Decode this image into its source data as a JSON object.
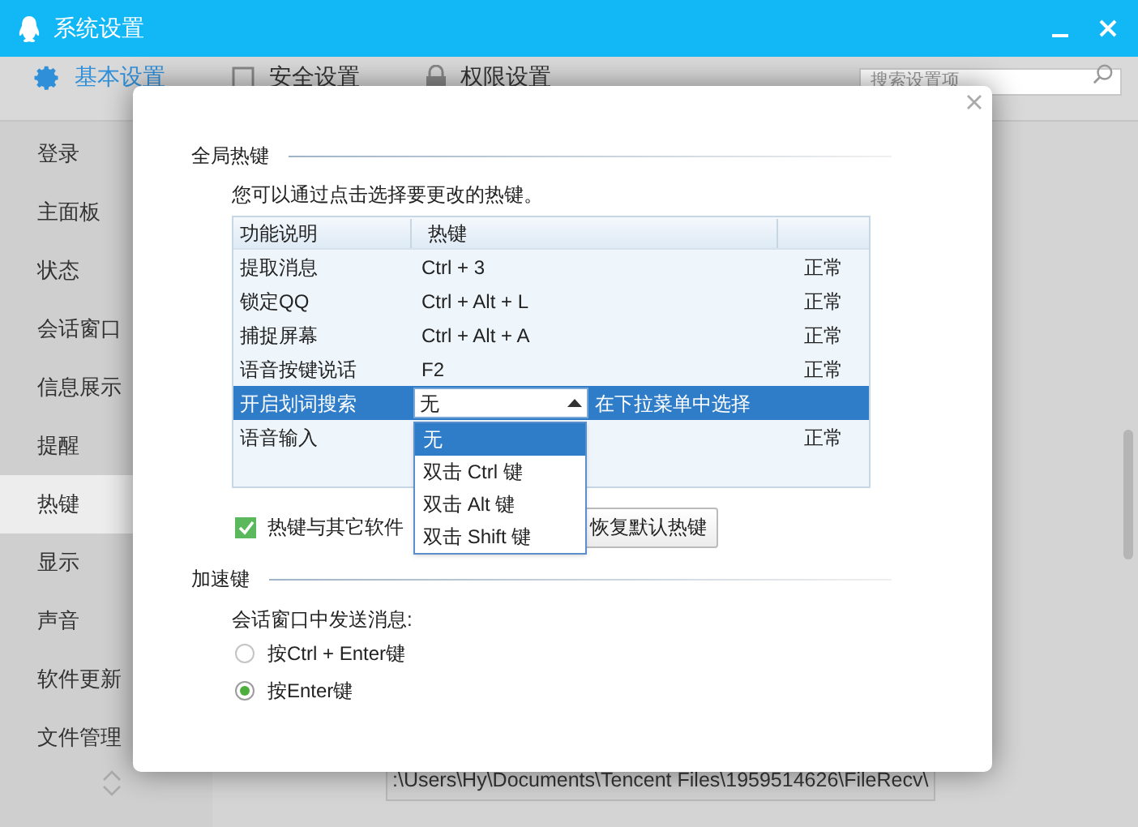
{
  "window": {
    "title": "系统设置"
  },
  "tabs": [
    {
      "label": "基本设置",
      "selected": true
    },
    {
      "label": "安全设置",
      "selected": false
    },
    {
      "label": "权限设置",
      "selected": false
    }
  ],
  "search": {
    "placeholder": "搜索设置项"
  },
  "sidebar": {
    "items": [
      {
        "label": "登录",
        "selected": false
      },
      {
        "label": "主面板",
        "selected": false
      },
      {
        "label": "状态",
        "selected": false
      },
      {
        "label": "会话窗口",
        "selected": false
      },
      {
        "label": "信息展示",
        "selected": false
      },
      {
        "label": "提醒",
        "selected": false
      },
      {
        "label": "热键",
        "selected": true
      },
      {
        "label": "显示",
        "selected": false
      },
      {
        "label": "声音",
        "selected": false
      },
      {
        "label": "软件更新",
        "selected": false
      },
      {
        "label": "文件管理",
        "selected": false
      }
    ]
  },
  "background_field": {
    "value": ":\\Users\\Hy\\Documents\\Tencent Files\\1959514626\\FileRecv\\"
  },
  "dialog": {
    "global_hotkeys": {
      "title": "全局热键",
      "description": "您可以通过点击选择要更改的热键。",
      "table": {
        "columns": [
          "功能说明",
          "热键"
        ],
        "rows": [
          {
            "name": "提取消息",
            "hotkey": "Ctrl + 3",
            "status": "正常",
            "selected": false
          },
          {
            "name": "锁定QQ",
            "hotkey": "Ctrl + Alt + L",
            "status": "正常",
            "selected": false
          },
          {
            "name": "捕捉屏幕",
            "hotkey": "Ctrl + Alt + A",
            "status": "正常",
            "selected": false
          },
          {
            "name": "语音按键说话",
            "hotkey": "F2",
            "status": "正常",
            "selected": false
          },
          {
            "name": "开启划词搜索",
            "hotkey": "无",
            "status": "在下拉菜单中选择",
            "selected": true
          },
          {
            "name": "语音输入",
            "status": "正常",
            "selected": false
          }
        ]
      },
      "dropdown": {
        "options": [
          {
            "label": "无",
            "selected": true
          },
          {
            "label": "双击 Ctrl 键",
            "selected": false
          },
          {
            "label": "双击 Alt 键",
            "selected": false
          },
          {
            "label": "双击 Shift 键",
            "selected": false
          }
        ]
      },
      "conflict_check": {
        "label": "热键与其它软件",
        "checked": true
      },
      "reset_button": "恢复默认热键"
    },
    "accelerator": {
      "title": "加速键",
      "prompt": "会话窗口中发送消息:",
      "options": [
        {
          "label": "按Ctrl + Enter键",
          "selected": false
        },
        {
          "label": "按Enter键",
          "selected": true
        }
      ]
    }
  }
}
